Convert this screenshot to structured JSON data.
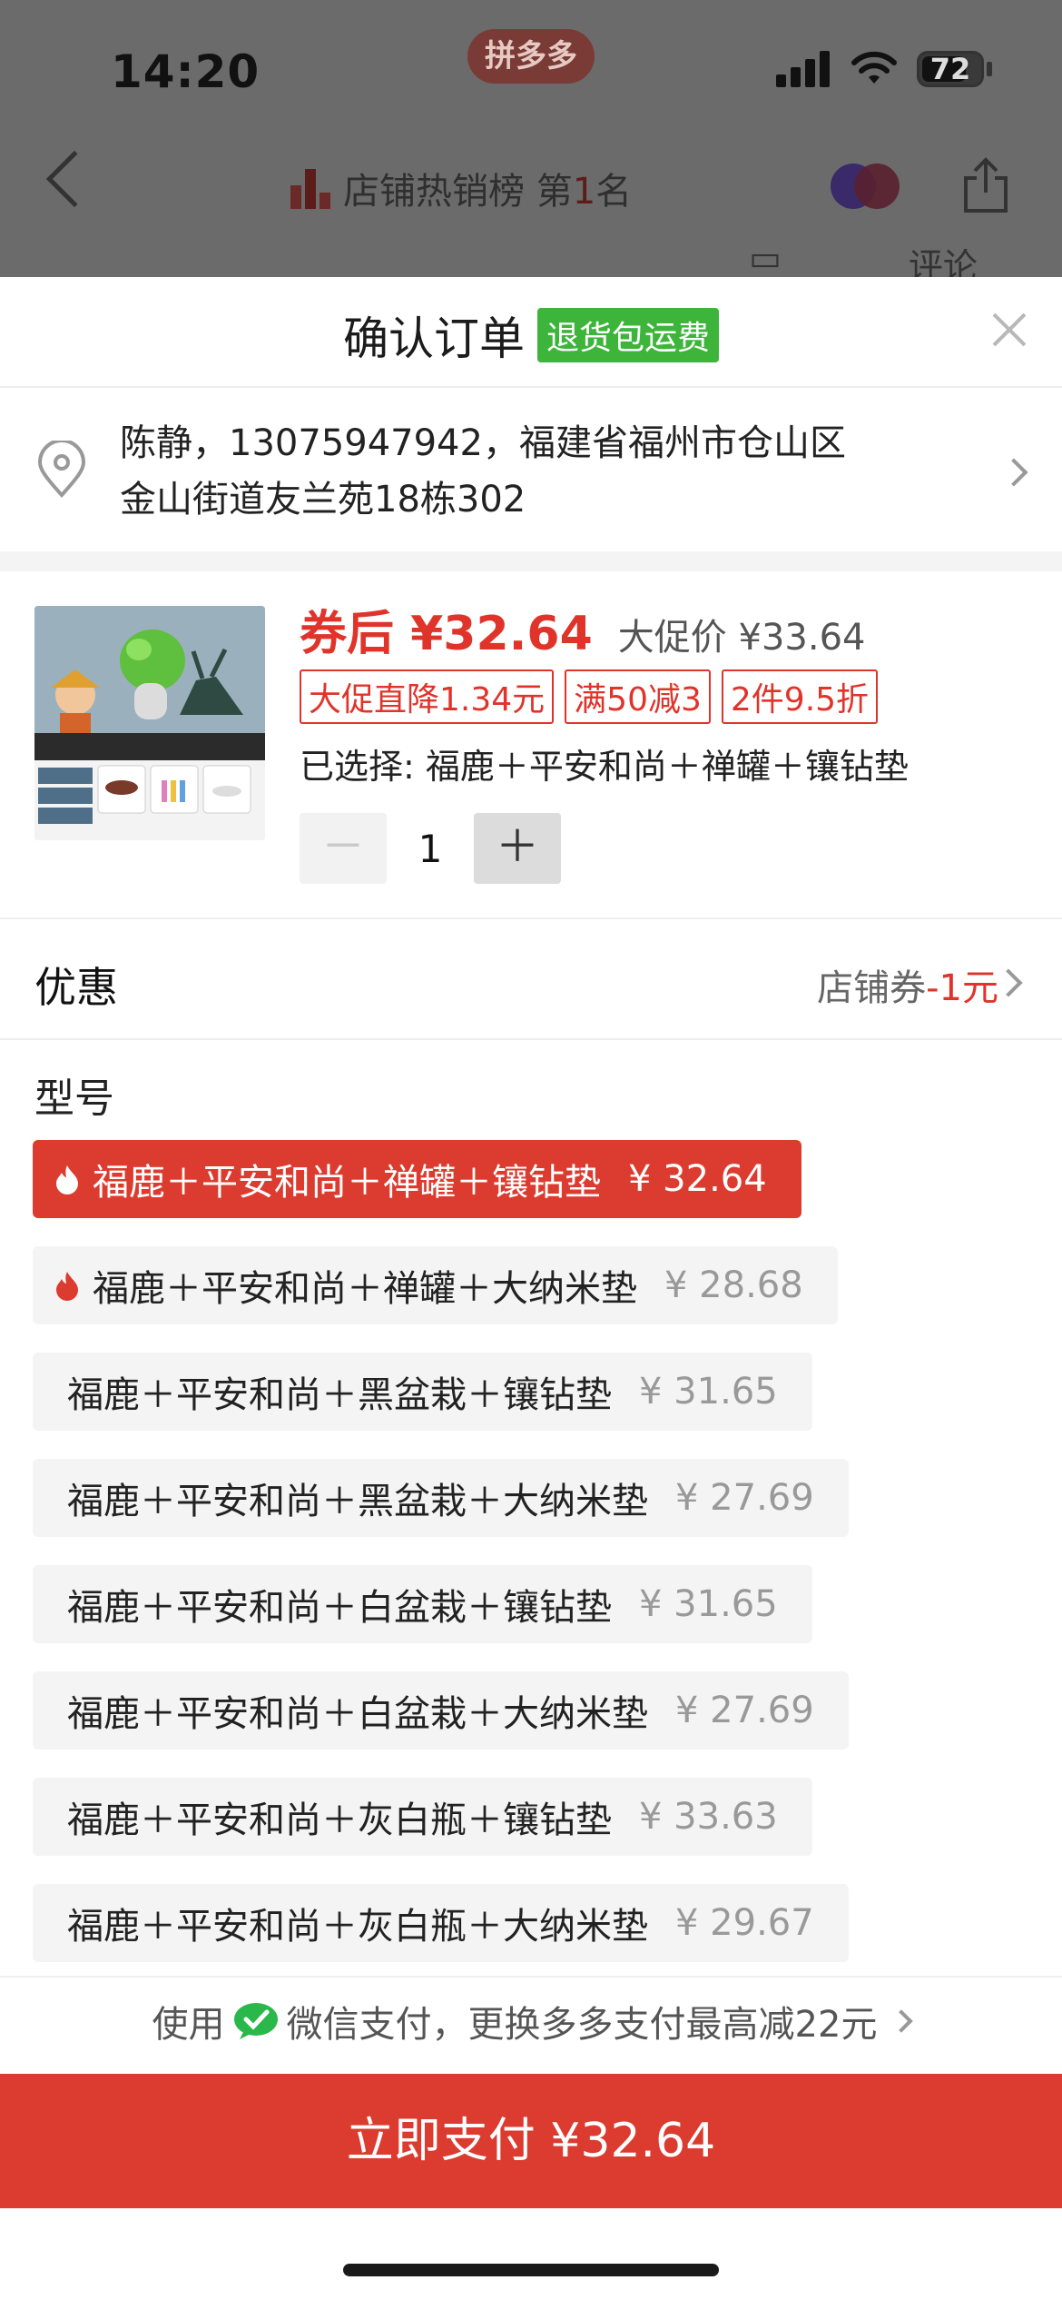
{
  "status_bar": {
    "time": "14:20",
    "brand": "拼多多",
    "battery": "72"
  },
  "background": {
    "hot_rank_text": "店铺热销榜 第",
    "hot_rank_num": "1",
    "hot_rank_suffix": "名",
    "peek_labels": [
      "",
      "评论"
    ]
  },
  "sheet": {
    "title": "确认订单",
    "title_tag": "退货包运费"
  },
  "address": {
    "line1": "陈静，13075947942，福建省福州市仓山区",
    "line2": "金山街道友兰苑18栋302"
  },
  "product": {
    "price_after_label": "券后",
    "price_after": "¥32.64",
    "promo_price": "大促价 ¥33.64",
    "tags": [
      "大促直降1.34元",
      "满50减3",
      "2件9.5折"
    ],
    "selected_spec": "已选择: 福鹿＋平安和尚＋禅罐＋镶钻垫",
    "quantity": "1",
    "minus": "－",
    "plus": "＋"
  },
  "discount": {
    "label": "优惠",
    "value_prefix": "店铺券",
    "value_amount": "-1元"
  },
  "model": {
    "label": "型号",
    "variants": [
      {
        "name": "福鹿＋平安和尚＋禅罐＋镶钻垫",
        "price": "¥ 32.64"
      },
      {
        "name": "福鹿＋平安和尚＋禅罐＋大纳米垫",
        "price": "¥ 28.68"
      },
      {
        "name": "福鹿＋平安和尚＋黑盆栽＋镶钻垫",
        "price": "¥ 31.65"
      },
      {
        "name": "福鹿＋平安和尚＋黑盆栽＋大纳米垫",
        "price": "¥ 27.69"
      },
      {
        "name": "福鹿＋平安和尚＋白盆栽＋镶钻垫",
        "price": "¥ 31.65"
      },
      {
        "name": "福鹿＋平安和尚＋白盆栽＋大纳米垫",
        "price": "¥ 27.69"
      },
      {
        "name": "福鹿＋平安和尚＋灰白瓶＋镶钻垫",
        "price": "¥ 33.63"
      },
      {
        "name": "福鹿＋平安和尚＋灰白瓶＋大纳米垫",
        "price": "¥ 29.67"
      }
    ]
  },
  "payment": {
    "hint_prefix": "使用",
    "hint_method": "微信支付，更换多多支付最高减22元",
    "pay_button": "立即支付 ¥32.64"
  },
  "colors": {
    "accent": "#dc3b2f",
    "price_red": "#e0342a",
    "green_tag": "#3db53a",
    "wechat": "#2ab84a"
  }
}
